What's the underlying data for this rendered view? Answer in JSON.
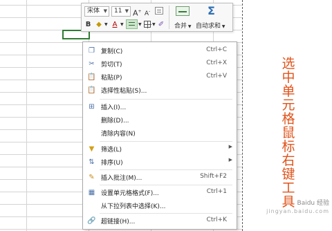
{
  "toolbar": {
    "font_name": "宋体",
    "font_size": "11",
    "grow_font_label": "A",
    "shrink_font_label": "A",
    "bold_label": "B",
    "font_color_label": "A",
    "merge_label": "合并",
    "autosum_label": "自动求和",
    "sigma_label": "Σ"
  },
  "menu": {
    "items": [
      {
        "icon": "copy-icon",
        "glyph": "❐",
        "label": "复制(C)",
        "shortcut": "Ctrl+C"
      },
      {
        "icon": "cut-icon",
        "glyph": "✂",
        "label": "剪切(T)",
        "shortcut": "Ctrl+X"
      },
      {
        "icon": "paste-icon",
        "glyph": "📋",
        "label": "粘贴(P)",
        "shortcut": "Ctrl+V"
      },
      {
        "icon": "paste-special-icon",
        "glyph": "📋",
        "label": "选择性粘贴(S)...",
        "shortcut": ""
      },
      {
        "icon": "insert-icon",
        "glyph": "⊞",
        "label": "插入(I)...",
        "shortcut": ""
      },
      {
        "icon": "",
        "glyph": "",
        "label": "删除(D)...",
        "shortcut": ""
      },
      {
        "icon": "",
        "glyph": "",
        "label": "清除内容(N)",
        "shortcut": ""
      },
      {
        "icon": "filter-icon",
        "glyph": "▼",
        "label": "筛选(L)",
        "shortcut": "",
        "submenu": true
      },
      {
        "icon": "sort-icon",
        "glyph": "⇅",
        "label": "排序(U)",
        "shortcut": "",
        "submenu": true
      },
      {
        "icon": "comment-icon",
        "glyph": "✎",
        "label": "插入批注(M)...",
        "shortcut": "Shift+F2"
      },
      {
        "icon": "format-cells-icon",
        "glyph": "▦",
        "label": "设置单元格格式(F)...",
        "shortcut": "Ctrl+1"
      },
      {
        "icon": "",
        "glyph": "",
        "label": "从下拉列表中选择(K)...",
        "shortcut": ""
      },
      {
        "icon": "hyperlink-icon",
        "glyph": "🔗",
        "label": "超链接(H)...",
        "shortcut": "Ctrl+K"
      }
    ]
  },
  "annotation": {
    "text": "选中单元格鼠标右键工具"
  },
  "watermark": {
    "line1": "Baidu 经验",
    "line2": "jingyan.baidu.com"
  },
  "colors": {
    "accent_orange": "#e0531a",
    "selection_green": "#2e7d32"
  }
}
